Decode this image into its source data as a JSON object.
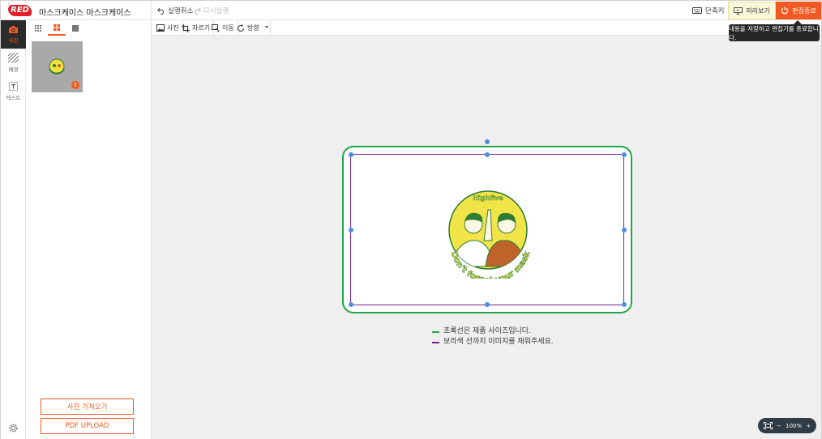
{
  "header": {
    "logo_text": "RED",
    "title": "마스크케이스 마스크케이스",
    "undo_label": "실행취소",
    "redo_label": "다시실행",
    "shortcut_label": "단축키",
    "preview_label": "미리보기",
    "end_label": "편집종료",
    "tooltip": "내용을 저장하고 편집기를 종료합니다."
  },
  "rail": {
    "items": [
      {
        "label": "사진",
        "icon": "camera-icon",
        "active": true
      },
      {
        "label": "배경",
        "icon": "background-pattern-icon",
        "active": false
      },
      {
        "label": "텍스트",
        "icon": "text-frame-icon",
        "active": false
      }
    ]
  },
  "panel": {
    "thumb_badge": "!",
    "import_photo_label": "사진 가져오기",
    "pdf_upload_label": "PDF UPLOAD"
  },
  "toolbar": {
    "photo_label": "사진",
    "crop_label": "자르기",
    "move_label": "이동",
    "direction_label": "방향"
  },
  "canvas": {
    "design_top_text": "Highfive",
    "design_bottom_text": "Don't forget your mask",
    "legend_green": "초록선은 제품 사이즈입니다.",
    "legend_purple": "보라색 선까지 이미지를 채워주세요.",
    "colors": {
      "product_line": "#22a64b",
      "image_line": "#7a1f8c",
      "accent": "#f15a22"
    }
  },
  "zoom": {
    "level": "100%",
    "minus": "−",
    "plus": "+"
  }
}
